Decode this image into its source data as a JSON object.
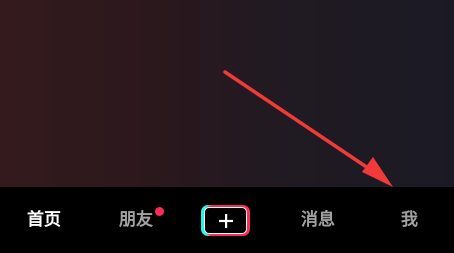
{
  "tabbar": {
    "tabs": [
      {
        "label": "首页",
        "active": true
      },
      {
        "label": "朋友",
        "active": false,
        "badge": "dot"
      },
      {
        "label": "消息",
        "active": false
      },
      {
        "label": "我",
        "active": false
      }
    ],
    "create_icon": "plus-icon"
  },
  "annotation": {
    "icon": "arrow-icon",
    "color": "#f23a3a"
  },
  "colors": {
    "active_tab": "#ffffff",
    "inactive_tab": "#a3a3a3",
    "badge": "#fe2c55",
    "accent_cyan": "#25f4ee",
    "accent_red": "#fe2c55"
  }
}
